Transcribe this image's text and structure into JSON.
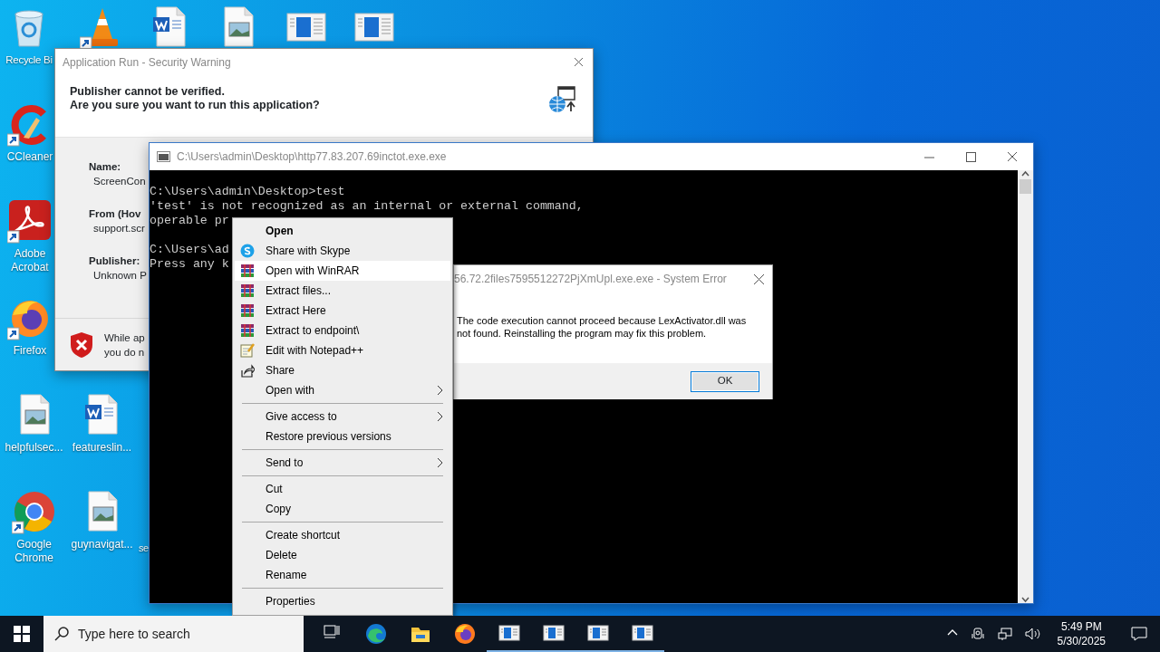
{
  "desktop": {
    "top_row": [
      {
        "kind": "recycle-bin",
        "label": "Recycle Bi",
        "shortcut": false
      },
      {
        "kind": "vlc",
        "shortcut": true
      },
      {
        "kind": "word-doc",
        "shortcut": false
      },
      {
        "kind": "image-file",
        "shortcut": false
      },
      {
        "kind": "window-app",
        "shortcut": false
      },
      {
        "kind": "window-app",
        "shortcut": false
      }
    ],
    "left_column": [
      {
        "kind": "ccleaner",
        "label": "CCleaner",
        "shortcut": true
      },
      {
        "kind": "acrobat",
        "label": "Adobe Acrobat",
        "shortcut": true
      },
      {
        "kind": "firefox",
        "label": "Firefox",
        "shortcut": true
      }
    ],
    "bottom_rows": [
      [
        {
          "kind": "image-file",
          "label": "helpfulsec...",
          "shortcut": false
        },
        {
          "kind": "word-doc",
          "label": "featureslin...",
          "shortcut": false
        }
      ],
      [
        {
          "kind": "chrome",
          "label": "Google Chrome",
          "shortcut": true
        },
        {
          "kind": "image-file",
          "label": "guynavigat...",
          "shortcut": false
        },
        {
          "label": "se"
        }
      ]
    ]
  },
  "security_window": {
    "title": "Application Run - Security Warning",
    "headline": [
      "Publisher cannot be verified.",
      "Are you sure you want to run this application?"
    ],
    "fields": [
      {
        "label": "Name:",
        "value": "ScreenCon"
      },
      {
        "label": "From (Hov",
        "value": "support.scr"
      },
      {
        "label": "Publisher:",
        "value": "Unknown P"
      }
    ],
    "warning": [
      "While ap",
      "you do n"
    ]
  },
  "console_window": {
    "title": "C:\\Users\\admin\\Desktop\\http77.83.207.69inctot.exe.exe",
    "blocks": [
      [
        "C:\\Users\\admin\\Desktop>test",
        "'test' is not recognized as an internal or external command,",
        "operable pr"
      ],
      [
        "C:\\Users\\ad",
        "Press any k"
      ]
    ]
  },
  "error_dialog": {
    "title": "56.72.2files7595512272PjXmUpl.exe.exe - System Error",
    "message": "The code execution cannot proceed because LexActivator.dll was not found. Reinstalling the program may fix this problem.",
    "button": "OK"
  },
  "context_menu": {
    "groups": [
      [
        {
          "label": "Open",
          "kind": "plain",
          "default": true,
          "submenu": false,
          "selected": false
        },
        {
          "label": "Share with Skype",
          "kind": "skype",
          "default": false,
          "submenu": false,
          "selected": false
        },
        {
          "label": "Open with WinRAR",
          "kind": "winrar",
          "default": false,
          "submenu": false,
          "selected": true
        },
        {
          "label": "Extract files...",
          "kind": "winrar",
          "default": false,
          "submenu": false,
          "selected": false
        },
        {
          "label": "Extract Here",
          "kind": "winrar",
          "default": false,
          "submenu": false,
          "selected": false
        },
        {
          "label": "Extract to endpoint\\",
          "kind": "winrar",
          "default": false,
          "submenu": false,
          "selected": false
        },
        {
          "label": "Edit with Notepad++",
          "kind": "notepad",
          "default": false,
          "submenu": false,
          "selected": false
        },
        {
          "label": "Share",
          "kind": "share",
          "default": false,
          "submenu": false,
          "selected": false
        },
        {
          "label": "Open with",
          "kind": "plain",
          "default": false,
          "submenu": true,
          "selected": false
        }
      ],
      [
        {
          "label": "Give access to",
          "kind": "plain",
          "default": false,
          "submenu": true,
          "selected": false
        },
        {
          "label": "Restore previous versions",
          "kind": "plain",
          "default": false,
          "submenu": false,
          "selected": false
        }
      ],
      [
        {
          "label": "Send to",
          "kind": "plain",
          "default": false,
          "submenu": true,
          "selected": false
        }
      ],
      [
        {
          "label": "Cut",
          "kind": "plain",
          "default": false,
          "submenu": false,
          "selected": false
        },
        {
          "label": "Copy",
          "kind": "plain",
          "default": false,
          "submenu": false,
          "selected": false
        }
      ],
      [
        {
          "label": "Create shortcut",
          "kind": "plain",
          "default": false,
          "submenu": false,
          "selected": false
        },
        {
          "label": "Delete",
          "kind": "plain",
          "default": false,
          "submenu": false,
          "selected": false
        },
        {
          "label": "Rename",
          "kind": "plain",
          "default": false,
          "submenu": false,
          "selected": false
        }
      ],
      [
        {
          "label": "Properties",
          "kind": "plain",
          "default": false,
          "submenu": false,
          "selected": false
        }
      ]
    ]
  },
  "taskbar": {
    "search": {
      "placeholder": "Type here to search"
    },
    "apps": [
      {
        "kind": "task-view",
        "running": false
      },
      {
        "kind": "edge",
        "running": false
      },
      {
        "kind": "explorer",
        "running": false
      },
      {
        "kind": "firefox",
        "running": false
      },
      {
        "kind": "window-app",
        "running": true
      },
      {
        "kind": "window-app",
        "running": true
      },
      {
        "kind": "window-app",
        "running": true
      },
      {
        "kind": "window-app",
        "running": true
      }
    ],
    "tray": [
      {
        "kind": "chevron"
      },
      {
        "kind": "device"
      },
      {
        "kind": "network"
      },
      {
        "kind": "speaker"
      }
    ],
    "clock": {
      "time": "5:49 PM",
      "date": "5/30/2025"
    }
  }
}
